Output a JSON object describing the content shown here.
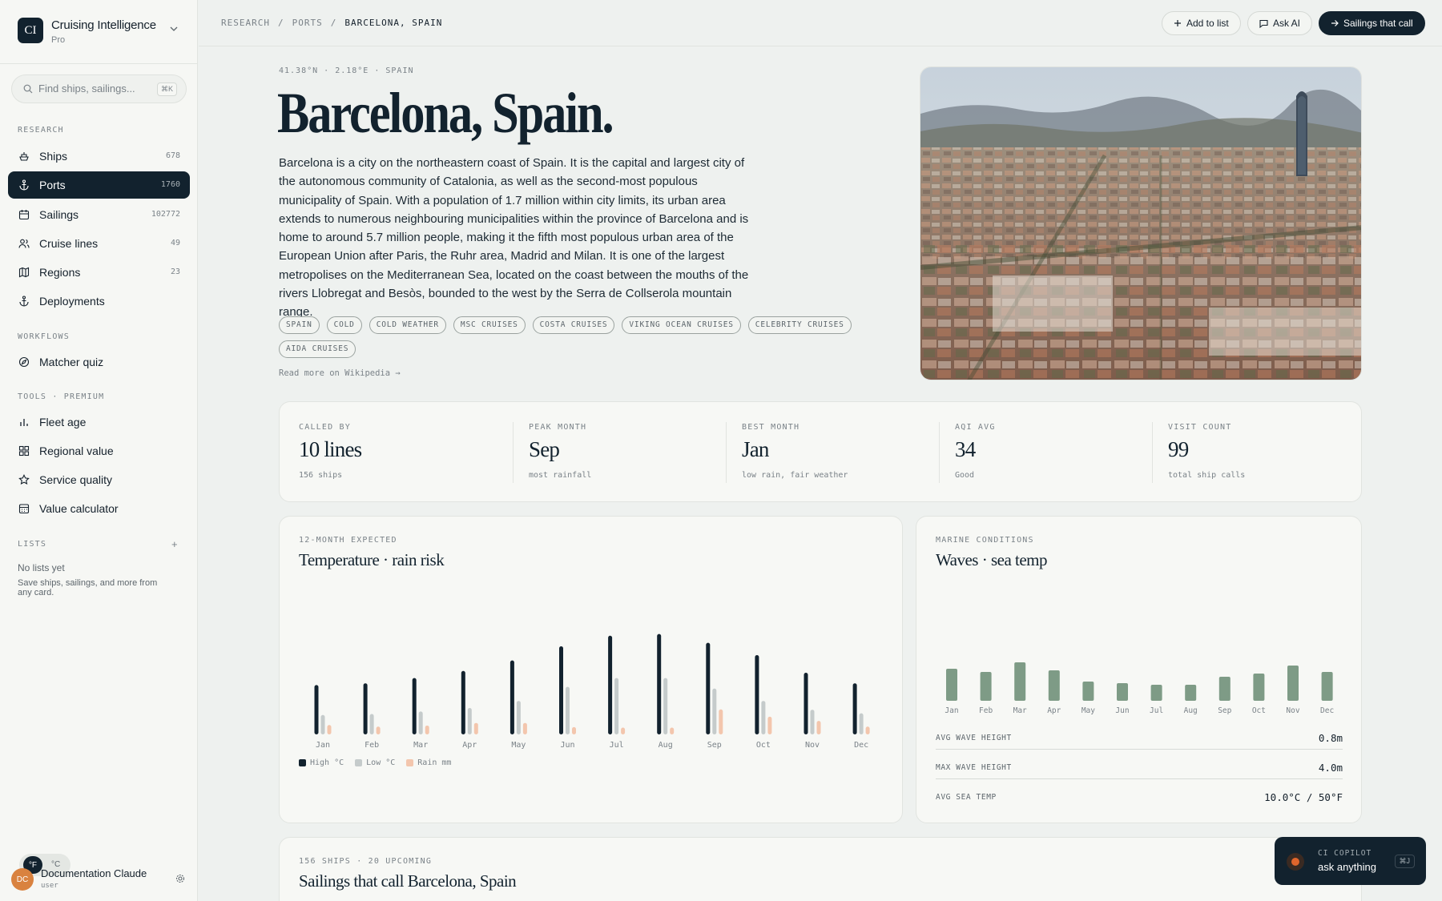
{
  "app": {
    "name": "Cruising Intelligence",
    "tier": "Pro",
    "logo_text": "CI"
  },
  "search": {
    "placeholder": "Find ships, sailings...",
    "shortcut": "⌘K"
  },
  "nav": {
    "research_label": "RESEARCH",
    "research_items": [
      {
        "label": "Ships",
        "count": "678",
        "icon": "ship-icon"
      },
      {
        "label": "Ports",
        "count": "1760",
        "icon": "anchor-icon",
        "active": true
      },
      {
        "label": "Sailings",
        "count": "102772",
        "icon": "calendar-icon"
      },
      {
        "label": "Cruise lines",
        "count": "49",
        "icon": "users-icon"
      },
      {
        "label": "Regions",
        "count": "23",
        "icon": "map-icon"
      },
      {
        "label": "Deployments",
        "count": "",
        "icon": "anchor-icon"
      }
    ],
    "workflows_label": "WORKFLOWS",
    "workflow_items": [
      {
        "label": "Matcher quiz",
        "icon": "compass-icon"
      }
    ],
    "tools_label": "TOOLS · PREMIUM",
    "tool_items": [
      {
        "label": "Fleet age",
        "icon": "bar-chart-icon"
      },
      {
        "label": "Regional value",
        "icon": "grid-icon"
      },
      {
        "label": "Service quality",
        "icon": "star-icon"
      },
      {
        "label": "Value calculator",
        "icon": "calculator-icon"
      }
    ],
    "lists_label": "LISTS",
    "lists_add": "+",
    "lists_empty": "No lists yet",
    "lists_hint": "Save ships, sailings, and more from any card."
  },
  "units": {
    "f": "°F",
    "c": "°C"
  },
  "user": {
    "initials": "DC",
    "name": "Documentation Claude",
    "role": "user"
  },
  "breadcrumb": {
    "root": "RESEARCH",
    "section": "PORTS",
    "current": "BARCELONA, SPAIN",
    "sep": "/"
  },
  "actions": {
    "add_to_list": "Add to list",
    "ask_ai": "Ask AI",
    "sailings": "Sailings that call"
  },
  "port": {
    "coords": "41.38°N · 2.18°E · SPAIN",
    "title": "Barcelona, Spain.",
    "description": "Barcelona is a city on the northeastern coast of Spain. It is the capital and largest city of the autonomous community of Catalonia, as well as the second-most populous municipality of Spain. With a population of 1.7 million within city limits, its urban area extends to numerous neighbouring municipalities within the province of Barcelona and is home to around 5.7 million people, making it the fifth most populous urban area of the European Union after Paris, the Ruhr area, Madrid and Milan. It is one of the largest metropolises on the Mediterranean Sea, located on the coast between the mouths of the rivers Llobregat and Besòs, bounded to the west by the Serra de Collserola mountain range.",
    "tags": [
      "SPAIN",
      "COLD",
      "COLD WEATHER",
      "MSC CRUISES",
      "COSTA CRUISES",
      "VIKING OCEAN CRUISES",
      "CELEBRITY CRUISES",
      "AIDA CRUISES"
    ],
    "read_more": "Read more on Wikipedia →"
  },
  "stats": [
    {
      "label": "CALLED BY",
      "value": "10 lines",
      "sub": "156 ships"
    },
    {
      "label": "PEAK MONTH",
      "value": "Sep",
      "sub": "most rainfall"
    },
    {
      "label": "BEST MONTH",
      "value": "Jan",
      "sub": "low rain, fair weather"
    },
    {
      "label": "AQI AVG",
      "value": "34",
      "sub": "Good"
    },
    {
      "label": "VISIT COUNT",
      "value": "99",
      "sub": "total ship calls"
    }
  ],
  "temp_panel": {
    "eyebrow": "12-MONTH EXPECTED",
    "title": "Temperature · rain risk"
  },
  "marine_panel": {
    "eyebrow": "MARINE CONDITIONS",
    "title": "Waves · sea temp",
    "rows": [
      {
        "label": "AVG WAVE HEIGHT",
        "value": "0.8m"
      },
      {
        "label": "MAX WAVE HEIGHT",
        "value": "4.0m"
      },
      {
        "label": "AVG SEA TEMP",
        "value": "10.0°C / 50°F"
      }
    ]
  },
  "sailings_panel": {
    "eyebrow": "156 SHIPS · 20 UPCOMING",
    "title": "Sailings that call Barcelona, Spain"
  },
  "copilot": {
    "label": "CI COPILOT",
    "prompt": "ask anything",
    "shortcut": "⌘J"
  },
  "colors": {
    "navy": "#12222e",
    "low": "#c5cbcb",
    "rain": "#f3c6ad",
    "wave": "#7e9b86",
    "accent": "#e0652c"
  },
  "chart_data": [
    {
      "type": "bar",
      "categories": [
        "Jan",
        "Feb",
        "Mar",
        "Apr",
        "May",
        "Jun",
        "Jul",
        "Aug",
        "Sep",
        "Oct",
        "Nov",
        "Dec"
      ],
      "series": [
        {
          "name": "High °C",
          "values": [
            14,
            14.5,
            16,
            18,
            21,
            25,
            28,
            28.5,
            26,
            22.5,
            17.5,
            14.5
          ]
        },
        {
          "name": "Low °C",
          "values": [
            5.5,
            5.8,
            6.5,
            7.5,
            9.5,
            13.5,
            16,
            16,
            13,
            9.5,
            7,
            6
          ]
        },
        {
          "name": "Rain mm",
          "values": [
            18,
            15,
            17,
            22,
            22,
            14,
            13,
            13,
            48,
            34,
            26,
            15
          ]
        }
      ]
    },
    {
      "type": "bar",
      "categories": [
        "Jan",
        "Feb",
        "Mar",
        "Apr",
        "May",
        "Jun",
        "Jul",
        "Aug",
        "Sep",
        "Oct",
        "Nov",
        "Dec"
      ],
      "series": [
        {
          "values": [
            1.0,
            0.9,
            1.2,
            0.95,
            0.6,
            0.55,
            0.5,
            0.5,
            0.75,
            0.85,
            1.1,
            0.9
          ]
        }
      ]
    }
  ]
}
